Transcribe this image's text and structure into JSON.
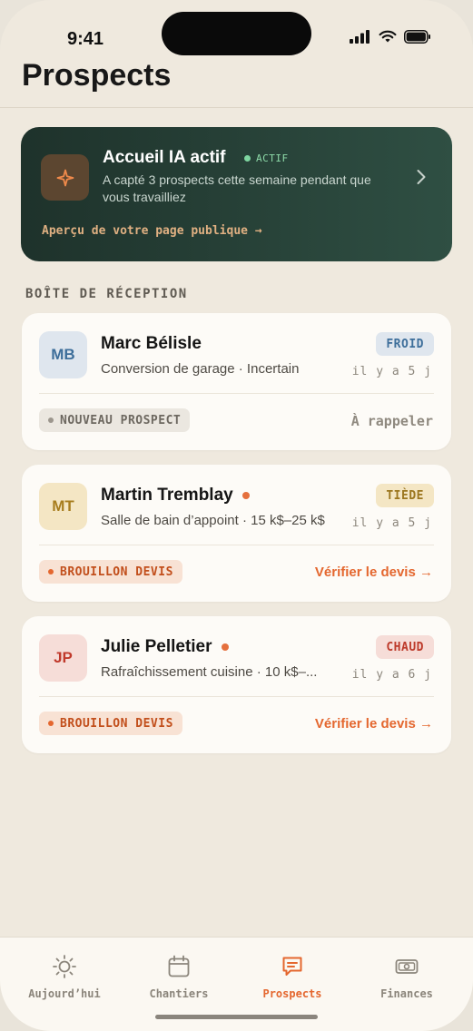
{
  "status_bar": {
    "time": "9:41"
  },
  "header": {
    "title": "Prospects"
  },
  "ai_banner": {
    "title": "Accueil IA actif",
    "status": "ACTIF",
    "description": "A capté 3 prospects cette semaine pendant que vous travailliez",
    "link": "Aperçu de votre page publique →",
    "icon": "sparkle-icon"
  },
  "inbox": {
    "label": "BOÎTE DE RÉCEPTION",
    "leads": [
      {
        "initials": "MB",
        "name": "Marc Bélisle",
        "detail": "Conversion de garage · Incertain",
        "temperature": "FROID",
        "age": "il y a 5 j",
        "stage": "NOUVEAU PROSPECT",
        "action": "À rappeler",
        "is_new": false
      },
      {
        "initials": "MT",
        "name": "Martin Tremblay",
        "detail": "Salle de bain d’appoint · 15 k$–25 k$",
        "temperature": "TIÈDE",
        "age": "il y a 5 j",
        "stage": "BROUILLON DEVIS",
        "action": "Vérifier le devis →",
        "is_new": true
      },
      {
        "initials": "JP",
        "name": "Julie Pelletier",
        "detail": "Rafraîchissement cuisine · 10 k$–...",
        "temperature": "CHAUD",
        "age": "il y a 6 j",
        "stage": "BROUILLON DEVIS",
        "action": "Vérifier le devis →",
        "is_new": true
      }
    ]
  },
  "tabbar": {
    "tabs": [
      {
        "label": "Aujourd’hui",
        "icon": "sun-icon"
      },
      {
        "label": "Chantiers",
        "icon": "calendar-icon"
      },
      {
        "label": "Prospects",
        "icon": "message-icon",
        "active": true
      },
      {
        "label": "Finances",
        "icon": "banknote-icon"
      }
    ]
  },
  "colors": {
    "accent": "#e4672f",
    "banner_dark": "#1e322b",
    "background": "#efe9de",
    "cold": "#dfe6ee",
    "warm": "#f4e6c4",
    "hot": "#f6ddd8"
  }
}
